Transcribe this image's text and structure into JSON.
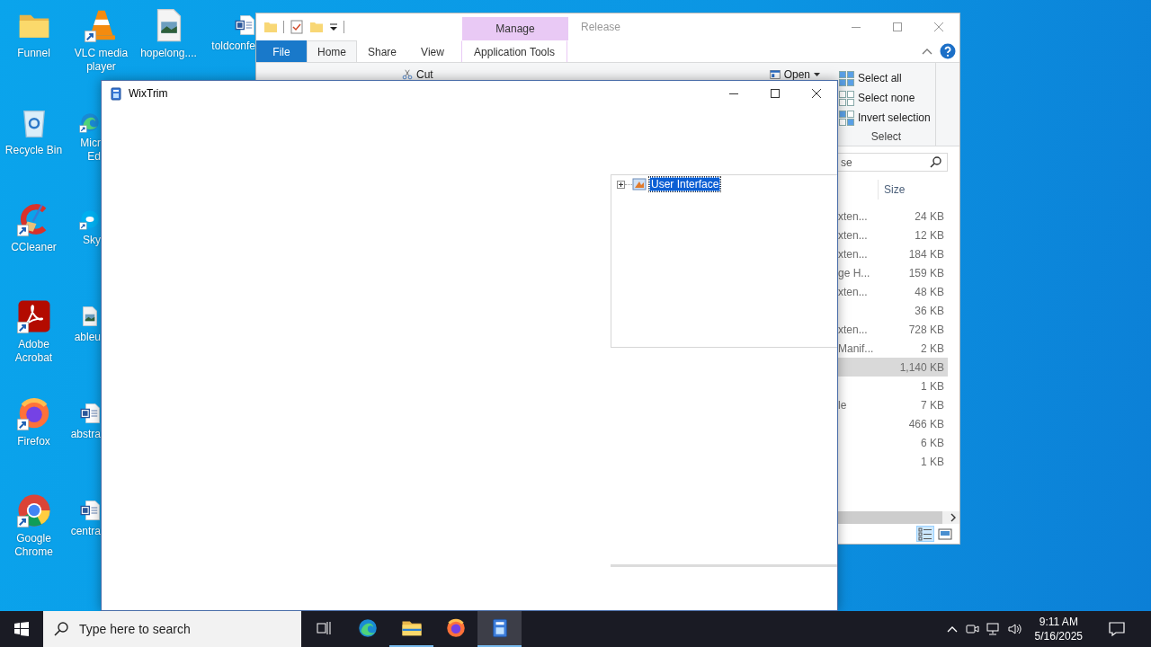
{
  "desktop": {
    "columns": [
      [
        {
          "kind": "folder",
          "label_lines": [
            "Funnel"
          ],
          "shortcut": false,
          "cut": false
        },
        {
          "kind": "recycle",
          "label_lines": [
            "Recycle Bin"
          ],
          "shortcut": false,
          "cut": false
        },
        {
          "kind": "ccleaner",
          "label_lines": [
            "CCleaner"
          ],
          "shortcut": true,
          "cut": false
        },
        {
          "kind": "acrobat",
          "label_lines": [
            "Adobe",
            "Acrobat"
          ],
          "shortcut": true,
          "cut": false
        },
        {
          "kind": "firefox",
          "label_lines": [
            "Firefox"
          ],
          "shortcut": true,
          "cut": false
        },
        {
          "kind": "chrome",
          "label_lines": [
            "Google",
            "Chrome"
          ],
          "shortcut": true,
          "cut": false
        }
      ],
      [
        {
          "kind": "vlc",
          "label_lines": [
            "VLC media",
            "player"
          ],
          "shortcut": true,
          "cut": false
        },
        {
          "kind": "edge",
          "label_lines": [
            "Micr",
            "Ed"
          ],
          "shortcut": true,
          "cut": true
        },
        {
          "kind": "skype",
          "label_lines": [
            "Sky"
          ],
          "shortcut": true,
          "cut": true
        },
        {
          "kind": "image",
          "label_lines": [
            "ableu"
          ],
          "shortcut": false,
          "cut": true
        },
        {
          "kind": "word",
          "label_lines": [
            "abstra"
          ],
          "shortcut": false,
          "cut": true
        },
        {
          "kind": "word",
          "label_lines": [
            "centra"
          ],
          "shortcut": false,
          "cut": true
        }
      ],
      [
        {
          "kind": "image",
          "label_lines": [
            "hopelong...."
          ],
          "shortcut": false,
          "cut": false
        }
      ],
      [
        {
          "kind": "word",
          "label_lines": [
            "toldconfe"
          ],
          "shortcut": false,
          "cut": true
        }
      ]
    ]
  },
  "explorer": {
    "title": "Release",
    "contextual_tab": "Manage",
    "tabs": [
      {
        "label": "File",
        "kind": "file",
        "selected": false
      },
      {
        "label": "Home",
        "kind": "normal",
        "selected": true
      },
      {
        "label": "Share",
        "kind": "normal",
        "selected": false
      },
      {
        "label": "View",
        "kind": "normal",
        "selected": false
      },
      {
        "label": "Application Tools",
        "kind": "contextual",
        "selected": false
      }
    ],
    "ribbon": {
      "cut": "Cut",
      "open": "Open",
      "select_group": {
        "label": "Select",
        "items": [
          {
            "kind": "all",
            "label": "Select all"
          },
          {
            "kind": "none",
            "label": "Select none"
          },
          {
            "kind": "invert",
            "label": "Invert selection"
          }
        ]
      }
    },
    "search": {
      "placeholder": "se"
    },
    "columns": [
      "Size"
    ],
    "rows": [
      {
        "type": "xten...",
        "size": "24 KB",
        "selected": false
      },
      {
        "type": "xten...",
        "size": "12 KB",
        "selected": false
      },
      {
        "type": "xten...",
        "size": "184 KB",
        "selected": false
      },
      {
        "type": "ge H...",
        "size": "159 KB",
        "selected": false
      },
      {
        "type": "xten...",
        "size": "48 KB",
        "selected": false
      },
      {
        "size": "36 KB",
        "selected": false
      },
      {
        "type": "xten...",
        "size": "728 KB",
        "selected": false
      },
      {
        "type": "Manif...",
        "size": "2 KB",
        "selected": false
      },
      {
        "size": "1,140 KB",
        "selected": true
      },
      {
        "size": "1 KB",
        "selected": false
      },
      {
        "type": "le",
        "size": "7 KB",
        "selected": false
      },
      {
        "size": "466 KB",
        "selected": false
      },
      {
        "size": "6 KB",
        "selected": false
      },
      {
        "size": "1 KB",
        "selected": false
      }
    ],
    "view_buttons": [
      {
        "kind": "details",
        "selected": true
      },
      {
        "kind": "preview",
        "selected": false
      }
    ]
  },
  "wixtrim": {
    "title": "WixTrim",
    "tree": [
      {
        "label": "User Interface",
        "selected": true,
        "expanded": false
      }
    ]
  },
  "taskbar": {
    "search": {
      "placeholder": "Type here to search"
    },
    "apps": [
      {
        "kind": "task-view",
        "running": false,
        "active": false
      },
      {
        "kind": "edge",
        "running": false,
        "active": false
      },
      {
        "kind": "explorer",
        "running": true,
        "active": false
      },
      {
        "kind": "firefox",
        "running": false,
        "active": false
      },
      {
        "kind": "wixtrim",
        "running": true,
        "active": true
      }
    ],
    "time": "9:11 AM",
    "date": "5/16/2025"
  }
}
